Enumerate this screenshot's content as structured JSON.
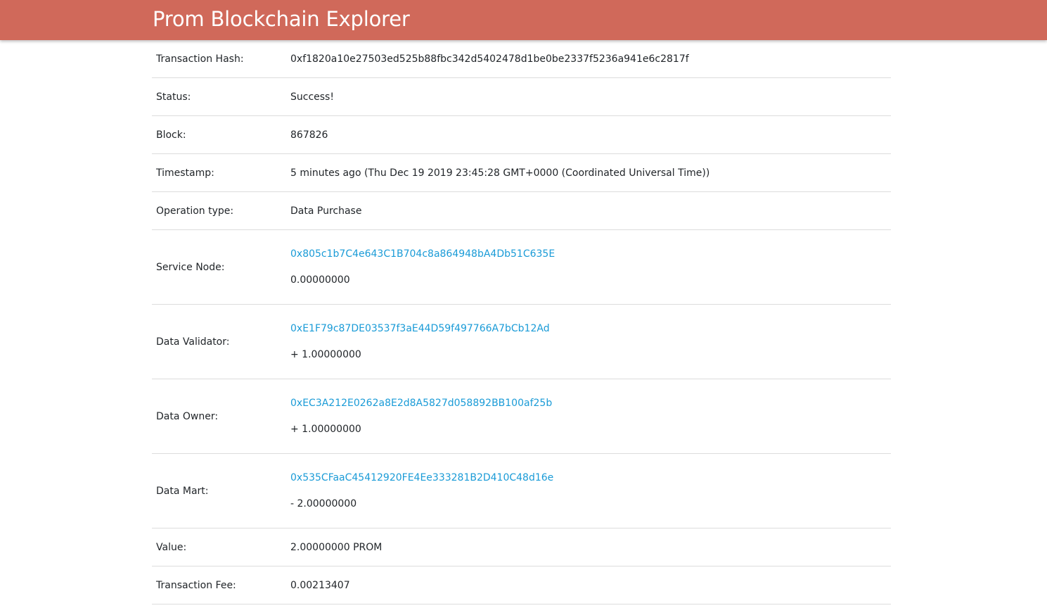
{
  "header": {
    "title": "Prom Blockchain Explorer",
    "bg_color": "#d0695a"
  },
  "link_color": "#1a9bd7",
  "transaction": {
    "hash": {
      "label": "Transaction Hash:",
      "value": "0xf1820a10e27503ed525b88fbc342d5402478d1be0be2337f5236a941e6c2817f"
    },
    "status": {
      "label": "Status:",
      "value": "Success!"
    },
    "block": {
      "label": "Block:",
      "value": "867826"
    },
    "timestamp": {
      "label": "Timestamp:",
      "value": "5 minutes ago (Thu Dec 19 2019 23:45:28 GMT+0000 (Coordinated Universal Time))"
    },
    "operation_type": {
      "label": "Operation type:",
      "value": "Data Purchase"
    },
    "service_node": {
      "label": "Service Node:",
      "address": "0x805c1b7C4e643C1B704c8a864948bA4Db51C635E",
      "amount": "0.00000000"
    },
    "data_validator": {
      "label": "Data Validator:",
      "address": "0xE1F79c87DE03537f3aE44D59f497766A7bCb12Ad",
      "amount": "+ 1.00000000"
    },
    "data_owner": {
      "label": "Data Owner:",
      "address": "0xEC3A212E0262a8E2d8A5827d058892BB100af25b",
      "amount": "+ 1.00000000"
    },
    "data_mart": {
      "label": "Data Mart:",
      "address": "0x535CFaaC45412920FE4Ee333281B2D410C48d16e",
      "amount": "- 2.00000000"
    },
    "value": {
      "label": "Value:",
      "value": "2.00000000 PROM"
    },
    "transaction_fee": {
      "label": "Transaction Fee:",
      "value": "0.00213407"
    }
  }
}
